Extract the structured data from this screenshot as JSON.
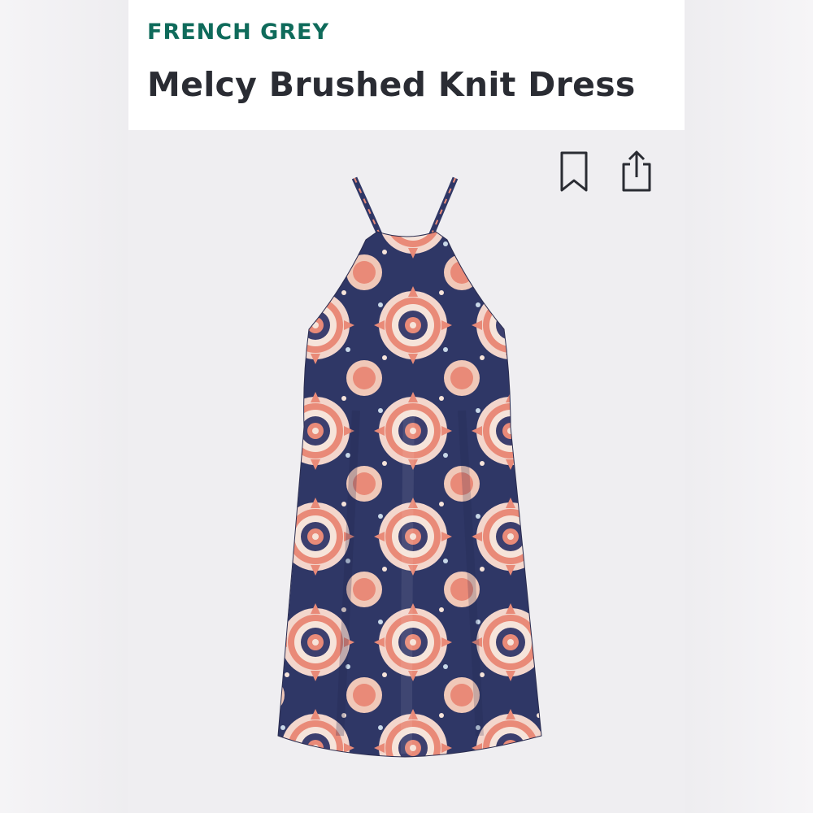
{
  "product": {
    "brand": "FRENCH GREY",
    "name": "Melcy Brushed Knit Dress"
  },
  "actions": {
    "save_icon": "bookmark-icon",
    "share_icon": "share-icon"
  },
  "colors": {
    "brand": "#0f6b5b",
    "title": "#2a2c33",
    "dress_navy": "#2f3766",
    "dress_coral": "#e98a78",
    "dress_cream": "#f6e4da"
  }
}
